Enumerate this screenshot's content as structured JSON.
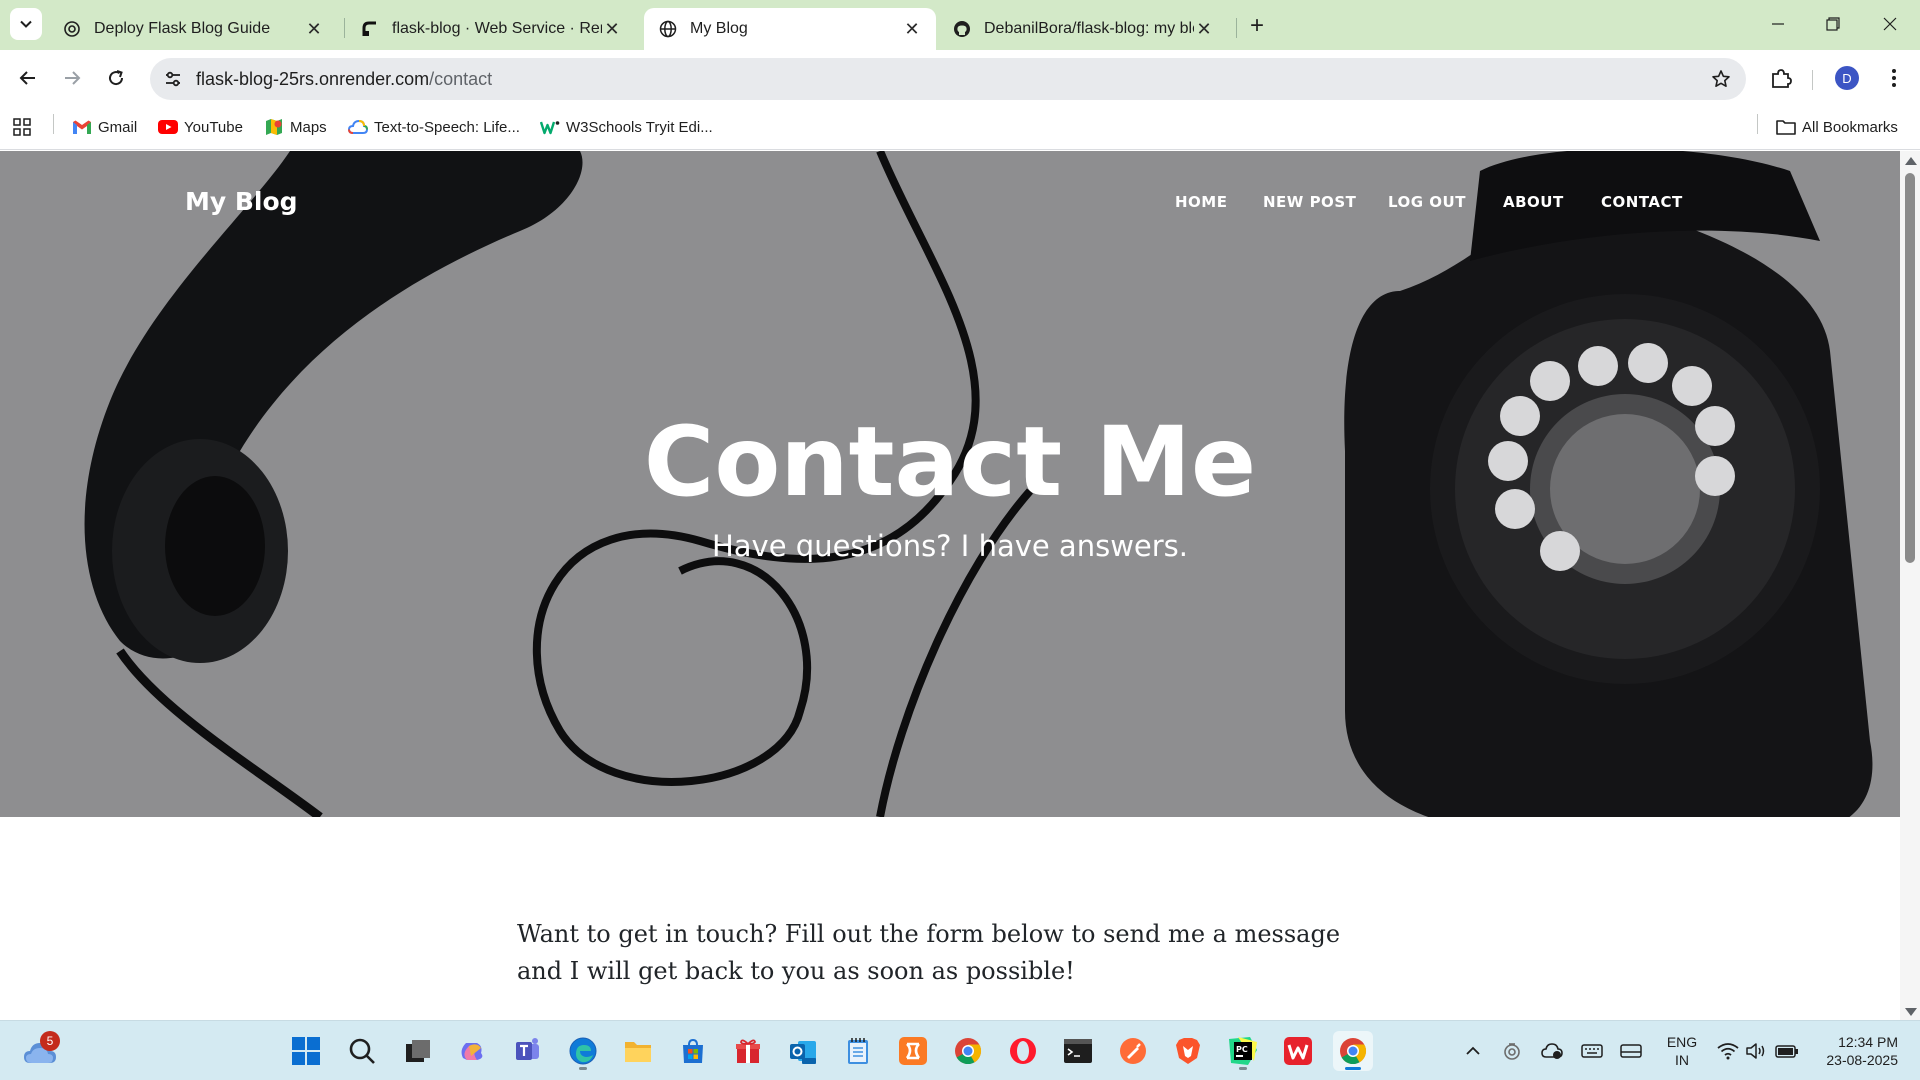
{
  "browser": {
    "tabs": [
      {
        "title": "Deploy Flask Blog Guide",
        "icon": "openai-icon",
        "active": false
      },
      {
        "title": "flask-blog · Web Service · Render",
        "icon": "render-icon",
        "active": false
      },
      {
        "title": "My Blog",
        "icon": "globe-icon",
        "active": true
      },
      {
        "title": "DebanilBora/flask-blog: my blog",
        "icon": "github-icon",
        "active": false
      }
    ],
    "new_tab_label": "+",
    "address": {
      "host": "flask-blog-25rs.onrender.com",
      "path": "/contact"
    },
    "profile_initial": "D",
    "bookmarks": [
      {
        "label": "Gmail",
        "icon": "gmail-icon"
      },
      {
        "label": "YouTube",
        "icon": "youtube-icon"
      },
      {
        "label": "Maps",
        "icon": "maps-icon"
      },
      {
        "label": "Text-to-Speech: Life...",
        "icon": "cloud-icon"
      },
      {
        "label": "W3Schools Tryit Edi...",
        "icon": "w3schools-icon"
      }
    ],
    "all_bookmarks_label": "All Bookmarks"
  },
  "site": {
    "brand": "My Blog",
    "nav": [
      "HOME",
      "NEW POST",
      "LOG OUT",
      "ABOUT",
      "CONTACT"
    ],
    "hero_title": "Contact Me",
    "hero_subtitle": "Have questions? I have answers.",
    "intro": "Want to get in touch? Fill out the form below to send me a message and I will get back to you as soon as possible!"
  },
  "taskbar": {
    "weather_badge": "5",
    "apps": [
      "start-icon",
      "search-icon",
      "task-view-icon",
      "copilot-icon",
      "teams-icon",
      "edge-icon",
      "file-explorer-icon",
      "store-icon",
      "gift-icon",
      "outlook-icon",
      "notepad-icon",
      "xampp-icon",
      "chrome-icon",
      "opera-icon",
      "terminal-icon",
      "postman-icon",
      "brave-icon",
      "pycharm-icon",
      "wps-icon",
      "chrome-active-icon"
    ],
    "language": "ENG",
    "region": "IN",
    "time": "12:34 PM",
    "date": "23-08-2025"
  },
  "colors": {
    "tabstrip": "#d3e9c8",
    "hero_overlay": "#8b8b8d",
    "taskbar": "#d4eaf2",
    "avatar": "#3c55c4"
  }
}
